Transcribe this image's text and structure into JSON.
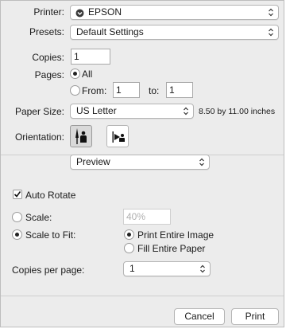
{
  "printer": {
    "label": "Printer:",
    "value": "EPSON",
    "icon": "printer-status-icon"
  },
  "presets": {
    "label": "Presets:",
    "value": "Default Settings"
  },
  "copies": {
    "label": "Copies:",
    "value": "1"
  },
  "pages": {
    "label": "Pages:",
    "all_label": "All",
    "from_label": "From:",
    "from_value": "1",
    "to_label": "to:",
    "to_value": "1",
    "selected": "all"
  },
  "paper_size": {
    "label": "Paper Size:",
    "value": "US Letter",
    "dimensions": "8.50 by 11.00 inches"
  },
  "orientation": {
    "label": "Orientation:",
    "selected": "portrait",
    "options": [
      "portrait-icon",
      "landscape-icon"
    ]
  },
  "section_menu": {
    "value": "Preview"
  },
  "auto_rotate": {
    "label": "Auto Rotate",
    "checked": true
  },
  "scale": {
    "label": "Scale:",
    "value": "40%",
    "enabled": false
  },
  "scale_to_fit": {
    "label": "Scale to Fit:",
    "selected": true,
    "option_print_entire": "Print Entire Image",
    "option_fill_entire": "Fill Entire Paper",
    "selected_option": "print_entire"
  },
  "copies_per_page": {
    "label": "Copies per page:",
    "value": "1"
  },
  "buttons": {
    "cancel": "Cancel",
    "print": "Print"
  },
  "colors": {
    "dialog_bg": "#ececec",
    "control_bg": "#ffffff",
    "text": "#1a1a1a",
    "disabled_text": "#b0b0b0"
  }
}
